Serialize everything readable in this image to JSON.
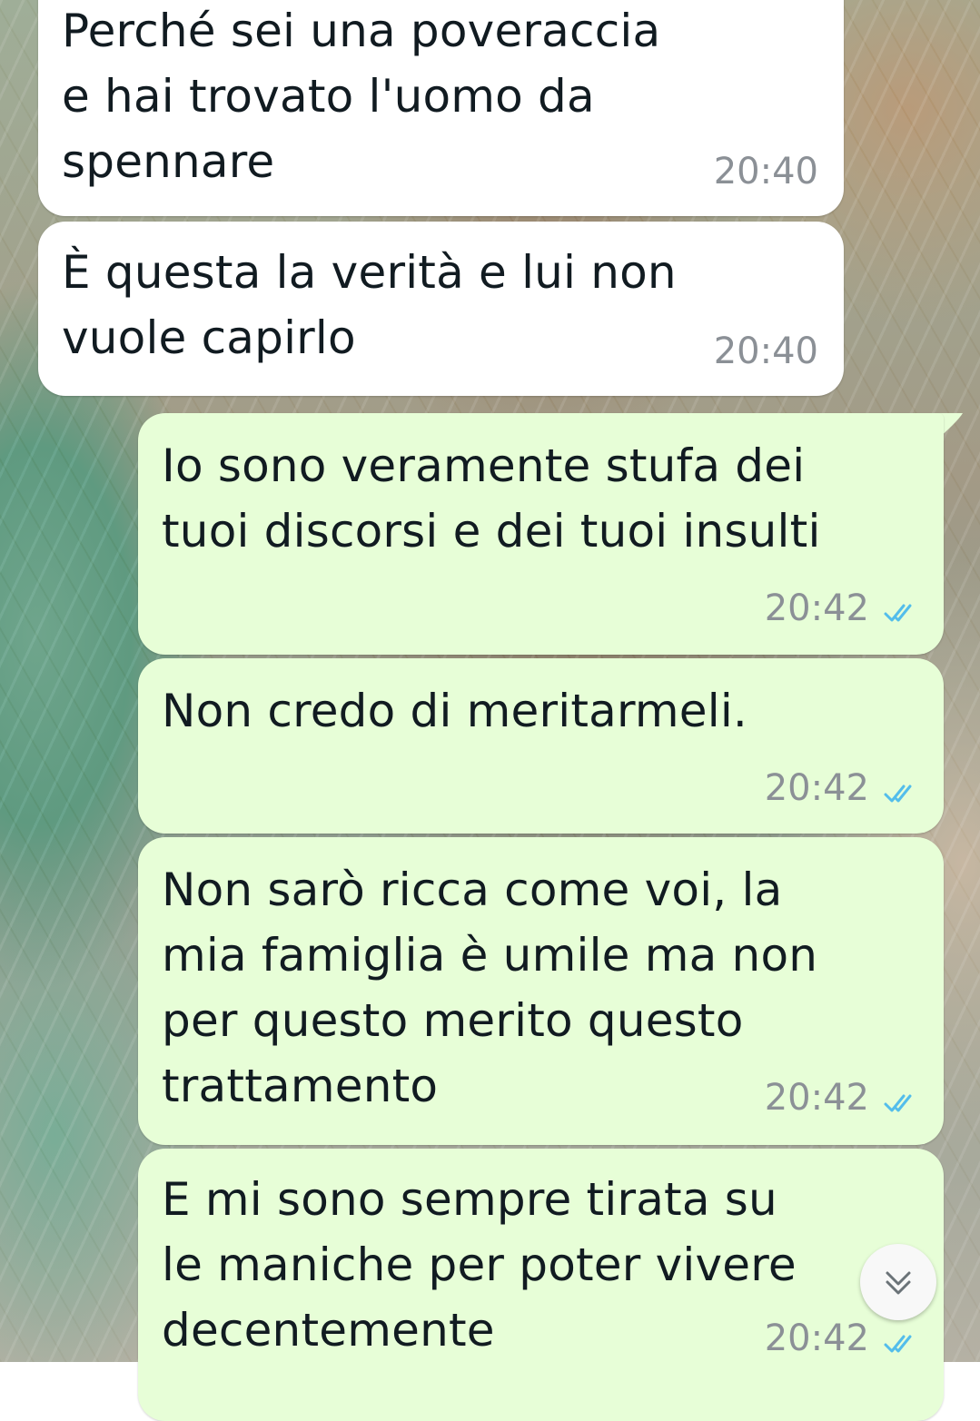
{
  "conversation": {
    "messages": [
      {
        "direction": "incoming",
        "text": "Perché sei una poveraccia\ne hai trovato l'uomo da\nspennare",
        "time": "20:40"
      },
      {
        "direction": "incoming",
        "text": "È questa la verità e lui non\nvuole capirlo",
        "time": "20:40"
      },
      {
        "direction": "outgoing",
        "text": "Io sono veramente stufa dei\ntuoi discorsi e dei tuoi insulti",
        "time": "20:42",
        "status": "read"
      },
      {
        "direction": "outgoing",
        "text": "Non credo di meritarmeli.",
        "time": "20:42",
        "status": "read"
      },
      {
        "direction": "outgoing",
        "text": "Non sarò ricca come voi, la\nmia famiglia è umile ma non\nper questo merito questo\ntrattamento",
        "time": "20:42",
        "status": "read"
      },
      {
        "direction": "outgoing",
        "text": "E mi sono sempre tirata su\nle maniche per poter vivere\ndecentemente",
        "time": "20:42",
        "status": "read"
      }
    ]
  },
  "icons": {
    "read_receipt": "double-check-icon",
    "scroll_down": "chevron-double-down-icon"
  },
  "colors": {
    "incoming_bubble": "#ffffff",
    "outgoing_bubble": "#e7fed7",
    "read_tick": "#53bdeb",
    "timestamp": "#8b9096"
  }
}
